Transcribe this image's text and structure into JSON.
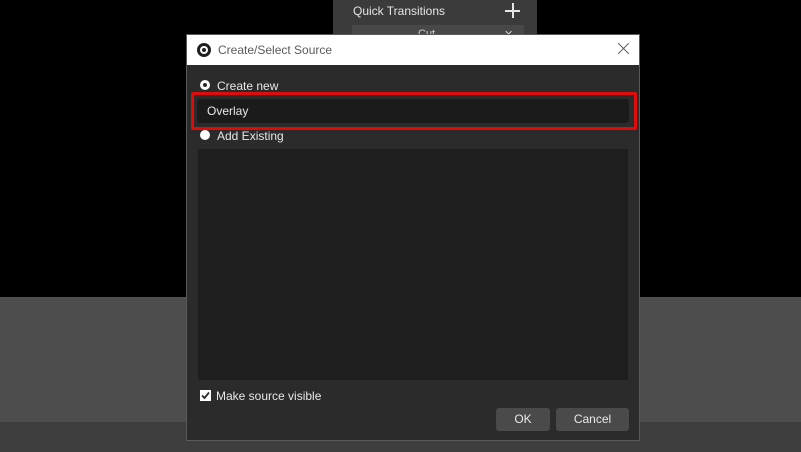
{
  "background": {
    "quick_transitions_label": "Quick Transitions",
    "transition_item_label": "Cut",
    "transition_item_close": "✕"
  },
  "dialog": {
    "title": "Create/Select Source",
    "create_new_label": "Create new",
    "name_value": "Overlay",
    "add_existing_label": "Add Existing",
    "make_visible_label": "Make source visible",
    "make_visible_checked": true,
    "ok_label": "OK",
    "cancel_label": "Cancel"
  },
  "colors": {
    "highlight": "#e00b0b",
    "dialog_bg": "#2b2b2b",
    "input_bg": "#1b1b1b"
  }
}
